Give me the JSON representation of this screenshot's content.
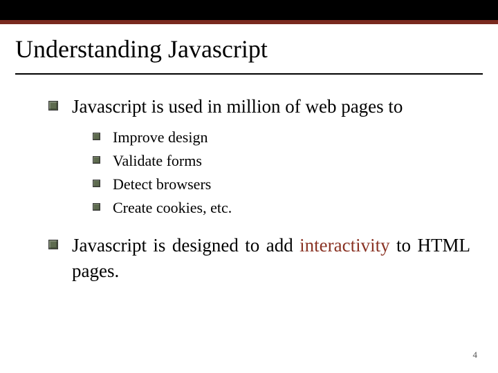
{
  "title": "Understanding Javascript",
  "bullets": {
    "b1": "Javascript is used in million of web pages to",
    "sub": {
      "s1": "Improve design",
      "s2": "Validate forms",
      "s3": "Detect browsers",
      "s4": "Create cookies, etc."
    },
    "b2_pre": "Javascript is designed to add ",
    "b2_hi": "interactivity",
    "b2_post": " to HTML pages."
  },
  "page_number": "4"
}
